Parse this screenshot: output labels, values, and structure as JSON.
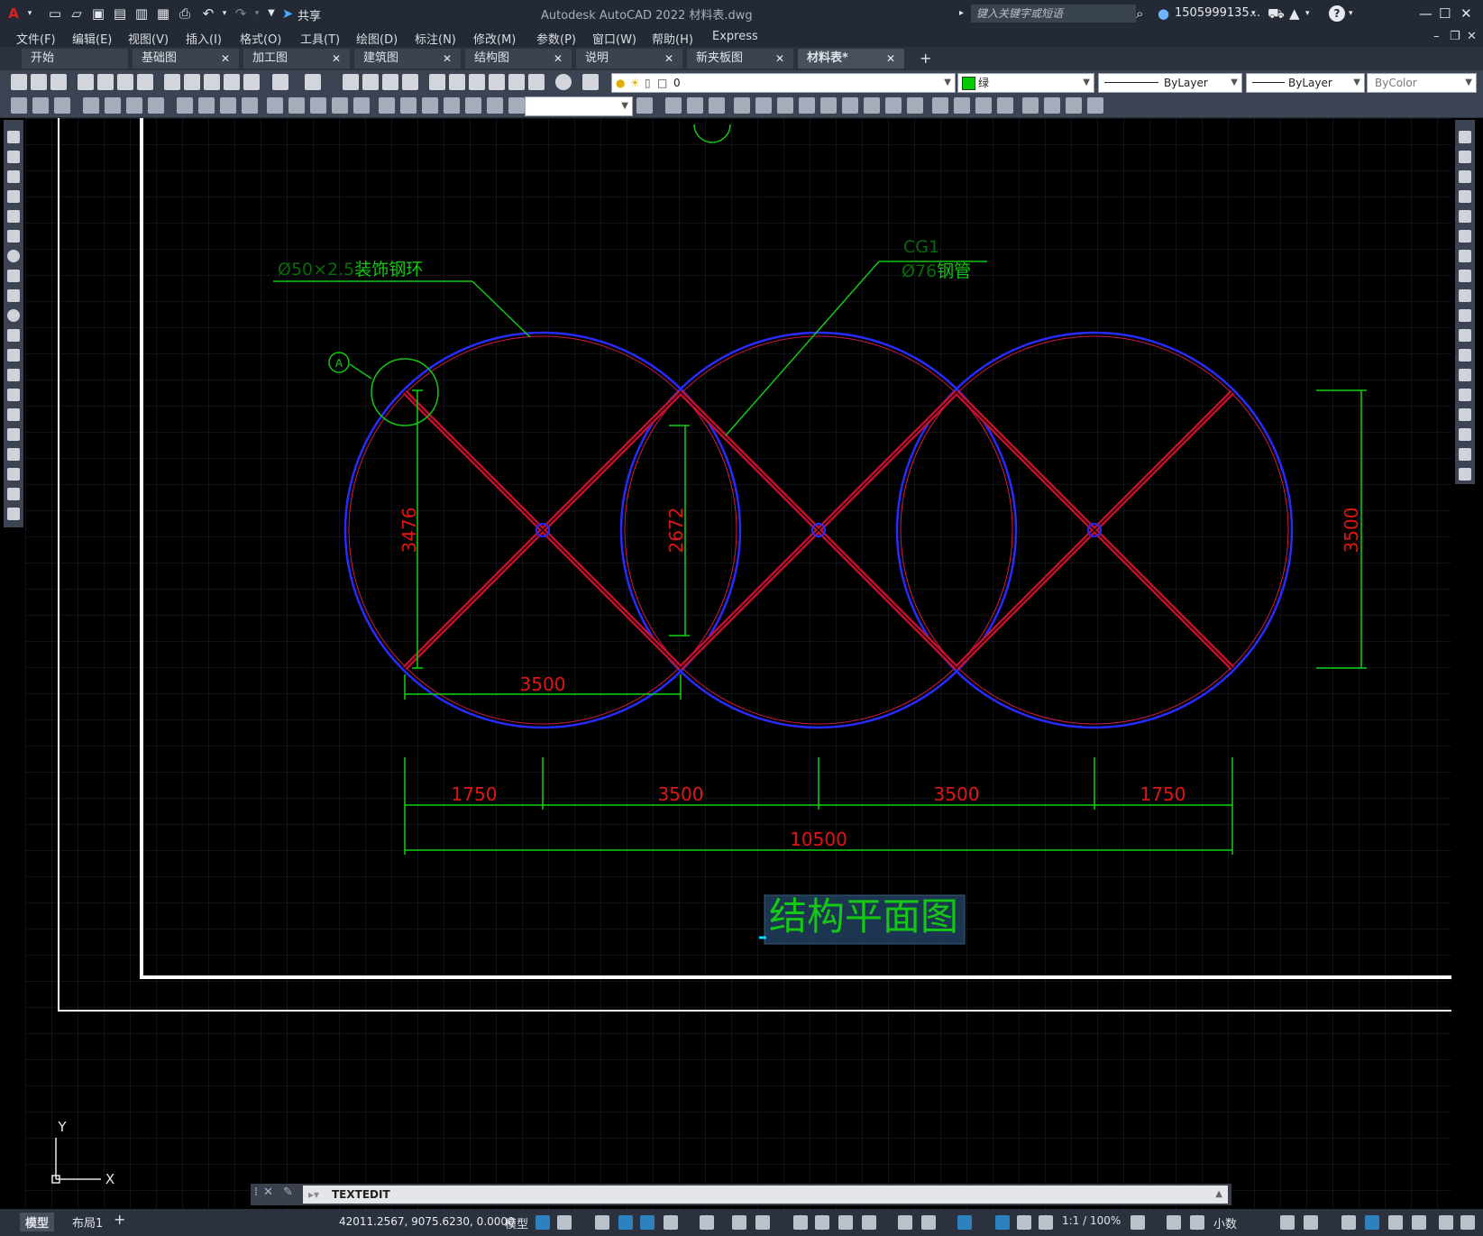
{
  "titlebar": {
    "app_title": "Autodesk AutoCAD 2022    材料表.dwg",
    "share_label": "共享",
    "search_placeholder": "键入关键字或短语",
    "user_id": "1505999135...",
    "help_symbol": "?"
  },
  "menu": [
    "文件(F)",
    "编辑(E)",
    "视图(V)",
    "插入(I)",
    "格式(O)",
    "工具(T)",
    "绘图(D)",
    "标注(N)",
    "修改(M)",
    "参数(P)",
    "窗口(W)",
    "帮助(H)",
    "Express"
  ],
  "tabs": [
    {
      "label": "开始",
      "closable": false
    },
    {
      "label": "基础图",
      "closable": true
    },
    {
      "label": "加工图",
      "closable": true
    },
    {
      "label": "建筑图",
      "closable": true
    },
    {
      "label": "结构图",
      "closable": true
    },
    {
      "label": "说明",
      "closable": true
    },
    {
      "label": "新夹板图",
      "closable": true
    },
    {
      "label": "材料表*",
      "closable": true,
      "active": true
    }
  ],
  "tab_close_symbol": "✕",
  "tab_add_symbol": "+",
  "properties": {
    "layer_value": "0",
    "color_value": "绿",
    "linetype_value": "ByLayer",
    "lineweight_value": "ByLayer",
    "plotstyle_value": "ByColor",
    "text_style_value": ""
  },
  "drawing": {
    "colors": {
      "circle": "#2a2aff",
      "circle_inner": "#d01a45",
      "brace": "#c4102e",
      "dimension_line": "#0fd30f",
      "dimension_text": "#e01515",
      "leader": "#14c814",
      "label_text": "#14c814",
      "label_faint": "#0a6a0a",
      "frame": "#ffffff",
      "grid": "#1f2633"
    },
    "leader_label_1_faint": "Ø50×2.5",
    "leader_label_1": "装饰钢环",
    "leader_label_2_top": "CG1",
    "leader_label_2_faint": "Ø76",
    "leader_label_2": "钢管",
    "callout_letter": "A",
    "dim_3476": "3476",
    "dim_2672": "2672",
    "dim_3500_vertical": "3500",
    "dim_3500_horizontal": "3500",
    "dim_row": [
      "1750",
      "3500",
      "3500",
      "1750"
    ],
    "dim_total": "10500",
    "plan_title": "结构平面图",
    "axis_y": "Y",
    "axis_x": "X"
  },
  "command": {
    "text": "TEXTEDIT"
  },
  "layout_tabs": [
    "模型",
    "布局1",
    "+"
  ],
  "status": {
    "coords": "42011.2567, 9075.6230, 0.0000",
    "model_label": "模型",
    "scale": "1:1 / 100%",
    "units": "小数"
  }
}
